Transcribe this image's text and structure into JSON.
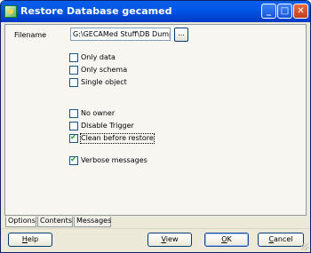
{
  "window": {
    "title": "Restore Database gecamed"
  },
  "titlebar_buttons": {
    "minimize": "_",
    "maximize": "□",
    "close": "✕"
  },
  "options": {
    "filename_label": "Filename",
    "filename_value": "G:\\GECAMed Stuff\\DB Dump",
    "browse_label": "...",
    "checkboxes": [
      {
        "label": "Only data",
        "checked": false
      },
      {
        "label": "Only schema",
        "checked": false
      },
      {
        "label": "Single object",
        "checked": false
      },
      {
        "label": "No owner",
        "checked": false
      },
      {
        "label": "Disable Trigger",
        "checked": false
      },
      {
        "label": "Clean before restore",
        "checked": true
      },
      {
        "label": "Verbose messages",
        "checked": true
      }
    ]
  },
  "tabs": [
    {
      "label": "Options",
      "active": true
    },
    {
      "label": "Contents",
      "active": false
    },
    {
      "label": "Messages",
      "active": false
    }
  ],
  "buttons": {
    "help": {
      "mnemonic": "H",
      "rest": "elp"
    },
    "view": {
      "mnemonic": "V",
      "rest": "iew"
    },
    "ok": {
      "mnemonic": "O",
      "rest": "K"
    },
    "cancel": {
      "mnemonic": "C",
      "rest": "ancel"
    }
  },
  "colors": {
    "titlebar": "#0058e6",
    "check": "#21a121",
    "dialog_bg": "#ece9d8"
  }
}
